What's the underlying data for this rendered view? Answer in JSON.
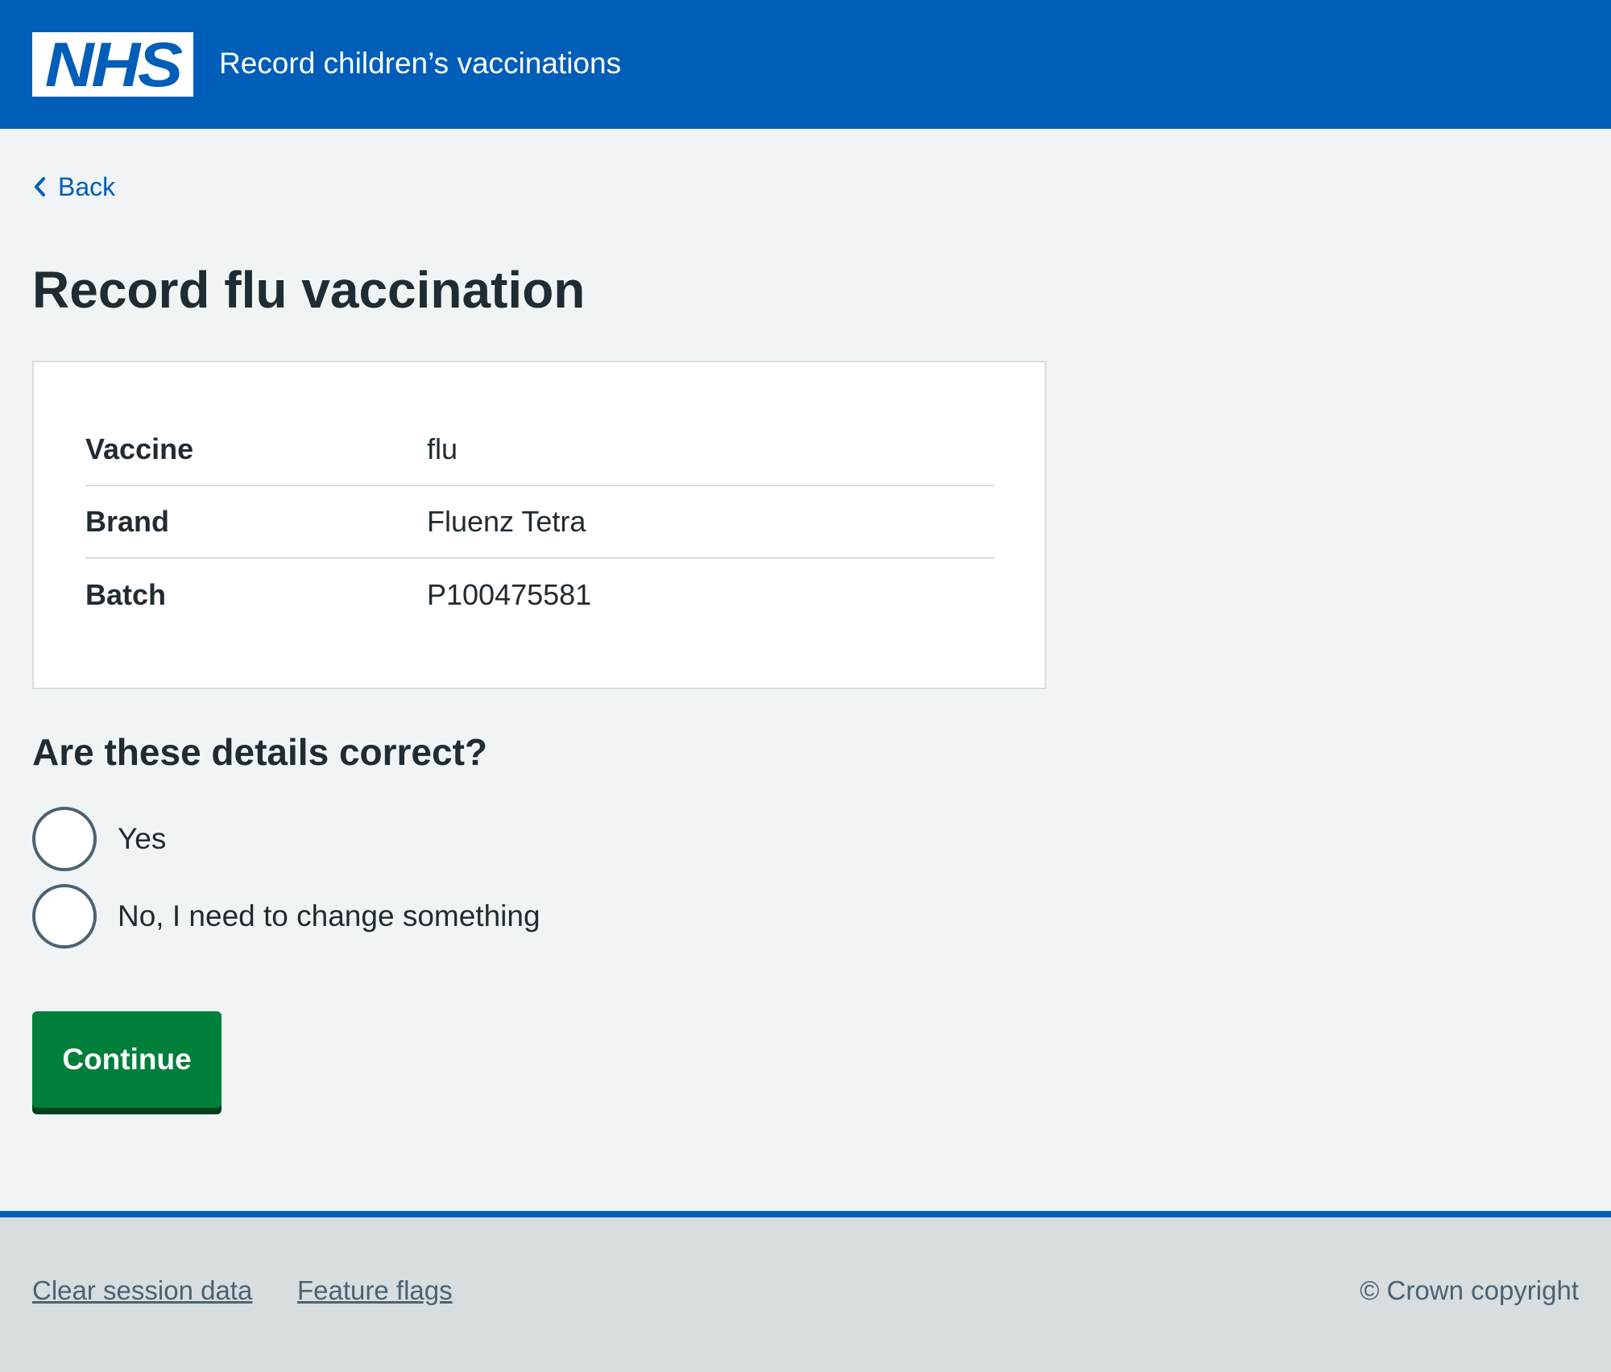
{
  "header": {
    "logo_text": "NHS",
    "service_name": "Record children’s vaccinations"
  },
  "nav": {
    "back_label": "Back"
  },
  "main": {
    "title": "Record flu vaccination",
    "summary": [
      {
        "key": "Vaccine",
        "value": "flu"
      },
      {
        "key": "Brand",
        "value": "Fluenz Tetra"
      },
      {
        "key": "Batch",
        "value": "P100475581"
      }
    ],
    "question": "Are these details correct?",
    "options": [
      {
        "label": "Yes",
        "selected": false
      },
      {
        "label": "No, I need to change something",
        "selected": false
      }
    ],
    "continue_label": "Continue"
  },
  "footer": {
    "links": [
      "Clear session data",
      "Feature flags"
    ],
    "copyright": "© Crown copyright"
  },
  "colors": {
    "header_blue": "#005eb8",
    "background": "#f0f4f5",
    "button_green": "#007f3b",
    "text": "#212b32",
    "secondary_text": "#4c6272",
    "border": "#d8dde0"
  }
}
